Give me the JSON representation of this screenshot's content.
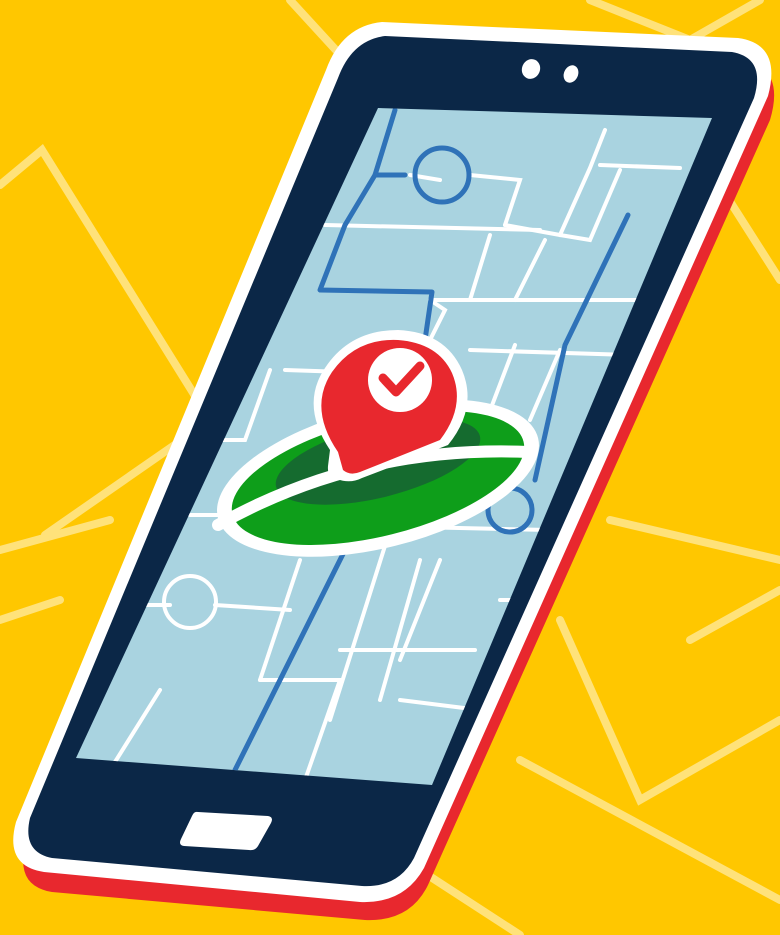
{
  "scene": {
    "subject": "smartphone-with-map-and-location-pin",
    "colors": {
      "background": "#FFC700",
      "background_lines": "#FFE27A",
      "phone_body": "#0B2747",
      "phone_outline": "#FFFFFF",
      "phone_edge": "#E8282E",
      "screen": "#A9D3E0",
      "map_streets": "#FFFFFF",
      "route": "#2F72B8",
      "pin": "#E8282E",
      "pin_inner": "#FFFFFF",
      "check": "#E8282E",
      "platform_light": "#0E9E1A",
      "platform_dark": "#156B2F"
    },
    "icons": [
      "location-pin-icon",
      "checkmark-icon",
      "camera-icon",
      "home-button-icon"
    ]
  }
}
